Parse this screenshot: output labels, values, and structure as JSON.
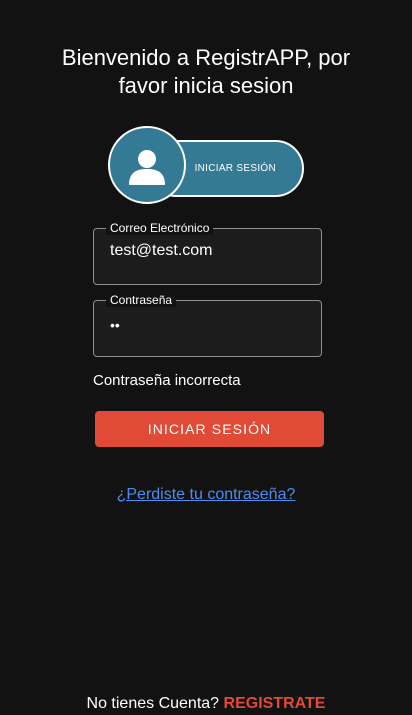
{
  "page": {
    "title": "Bienvenido a RegistrAPP, por favor inicia sesion"
  },
  "badge": {
    "label": "INICIAR SESIÓN",
    "icon": "user-icon",
    "color": "#357a94"
  },
  "form": {
    "email": {
      "label": "Correo Electrónico",
      "value": "test@test.com"
    },
    "password": {
      "label": "Contraseña",
      "value": "••"
    },
    "error": "Contraseña incorrecta",
    "submit_label": "INICIAR SESIÓN",
    "forgot_label": "¿Perdiste tu contraseña?"
  },
  "footer": {
    "prompt": "No tienes Cuenta?",
    "register_label": "REGISTRATE"
  },
  "colors": {
    "background": "#121212",
    "accent": "#e04a37",
    "link": "#4d8df0"
  }
}
